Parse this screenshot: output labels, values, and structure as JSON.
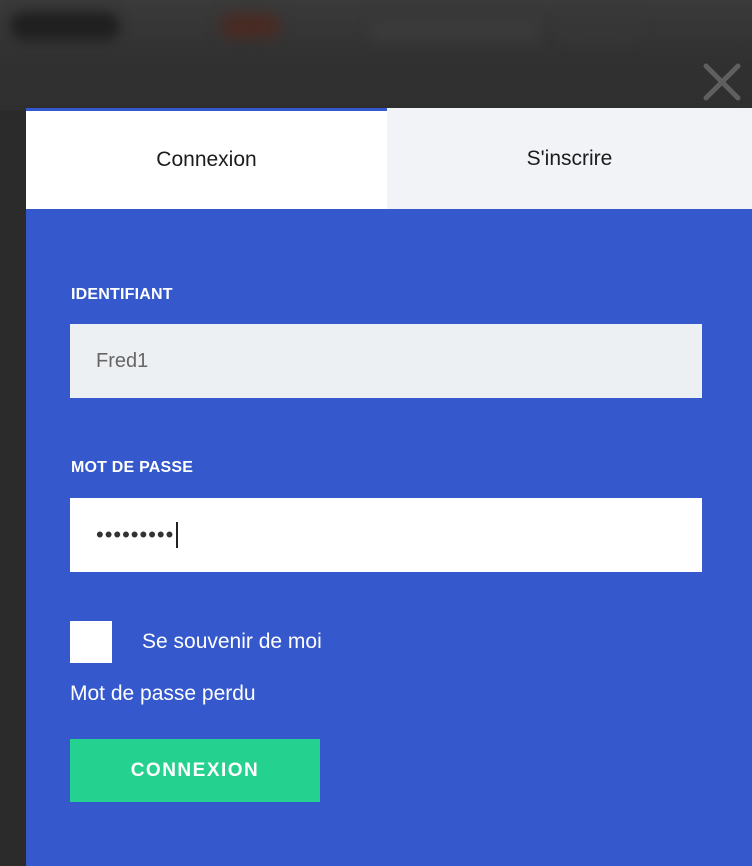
{
  "window": {
    "close_icon": "close-icon"
  },
  "tabs": [
    {
      "label": "Connexion",
      "active": true
    },
    {
      "label": "S'inscrire",
      "active": false
    }
  ],
  "form": {
    "username": {
      "label": "IDENTIFIANT",
      "value": "Fred1"
    },
    "password": {
      "label": "MOT DE PASSE",
      "masked_value": "•••••••••"
    },
    "remember_me": {
      "label": "Se souvenir de moi",
      "checked": false
    },
    "forgot_link": "Mot de passe perdu",
    "submit_label": "CONNEXION"
  },
  "colors": {
    "panel_bg": "#3559cc",
    "submit_bg": "#25d18e",
    "active_tab_bg": "#ffffff",
    "inactive_tab_bg": "#f1f3f7"
  }
}
